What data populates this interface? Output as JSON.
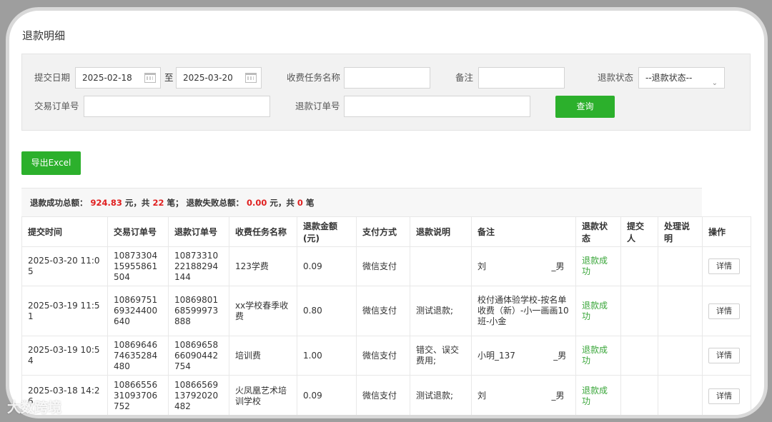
{
  "page_title": "退款明细",
  "filters": {
    "submit_date_label": "提交日期",
    "date_from": "2025-02-18",
    "date_to_sep": "至",
    "date_to": "2025-03-20",
    "task_name_label": "收费任务名称",
    "task_name_value": "",
    "remark_label": "备注",
    "remark_value": "",
    "refund_status_label": "退款状态",
    "refund_status_value": "--退款状态--",
    "trade_order_label": "交易订单号",
    "trade_order_value": "",
    "refund_order_label": "退款订单号",
    "refund_order_value": "",
    "query_button": "查询"
  },
  "export_button": "导出Excel",
  "summary": {
    "success_label": "退款成功总额：",
    "success_amount": "924.83",
    "success_unit": "元，共",
    "success_count": "22",
    "success_count_unit": "笔；",
    "fail_label": "退款失败总额：",
    "fail_amount": "0.00",
    "fail_unit": "元，共",
    "fail_count": "0",
    "fail_count_unit": "笔"
  },
  "table": {
    "headers": [
      "提交时间",
      "交易订单号",
      "退款订单号",
      "收费任务名称",
      "退款金额(元)",
      "支付方式",
      "退款说明",
      "备注",
      "退款状态",
      "提交人",
      "处理说明",
      "操作"
    ],
    "detail_label": "详情",
    "rows": [
      {
        "time": "2025-03-20 11:05",
        "trade_no": "1087330415955861504",
        "refund_no": "1087331022188294144",
        "task": "123学费",
        "amount": "0.09",
        "pay": "微信支付",
        "desc": "",
        "remark": "刘                        _男",
        "status": "退款成功",
        "submitter": "",
        "handle": ""
      },
      {
        "time": "2025-03-19 11:51",
        "trade_no": "1086975169324400640",
        "refund_no": "1086980168599973888",
        "task": "xx学校春季收费",
        "amount": "0.80",
        "pay": "微信支付",
        "desc": "测试退款;",
        "remark": "校付通体验学校-按名单收费（新）-小一画画10班-小金",
        "status": "退款成功",
        "submitter": "",
        "handle": ""
      },
      {
        "time": "2025-03-19 10:54",
        "trade_no": "1086964674635284480",
        "refund_no": "1086965866090442754",
        "task": "培训费",
        "amount": "1.00",
        "pay": "微信支付",
        "desc": "错交、误交费用;",
        "remark": "小明_137              _男",
        "status": "退款成功",
        "submitter": "",
        "handle": ""
      },
      {
        "time": "2025-03-18 14:26",
        "trade_no": "1086655631093706752",
        "refund_no": "1086656913792020482",
        "task": "火凤凰艺术培训学校",
        "amount": "0.09",
        "pay": "微信支付",
        "desc": "测试退款;",
        "remark": "刘                        _男",
        "status": "退款成功",
        "submitter": "",
        "handle": ""
      }
    ]
  },
  "watermark": "大数跨境"
}
